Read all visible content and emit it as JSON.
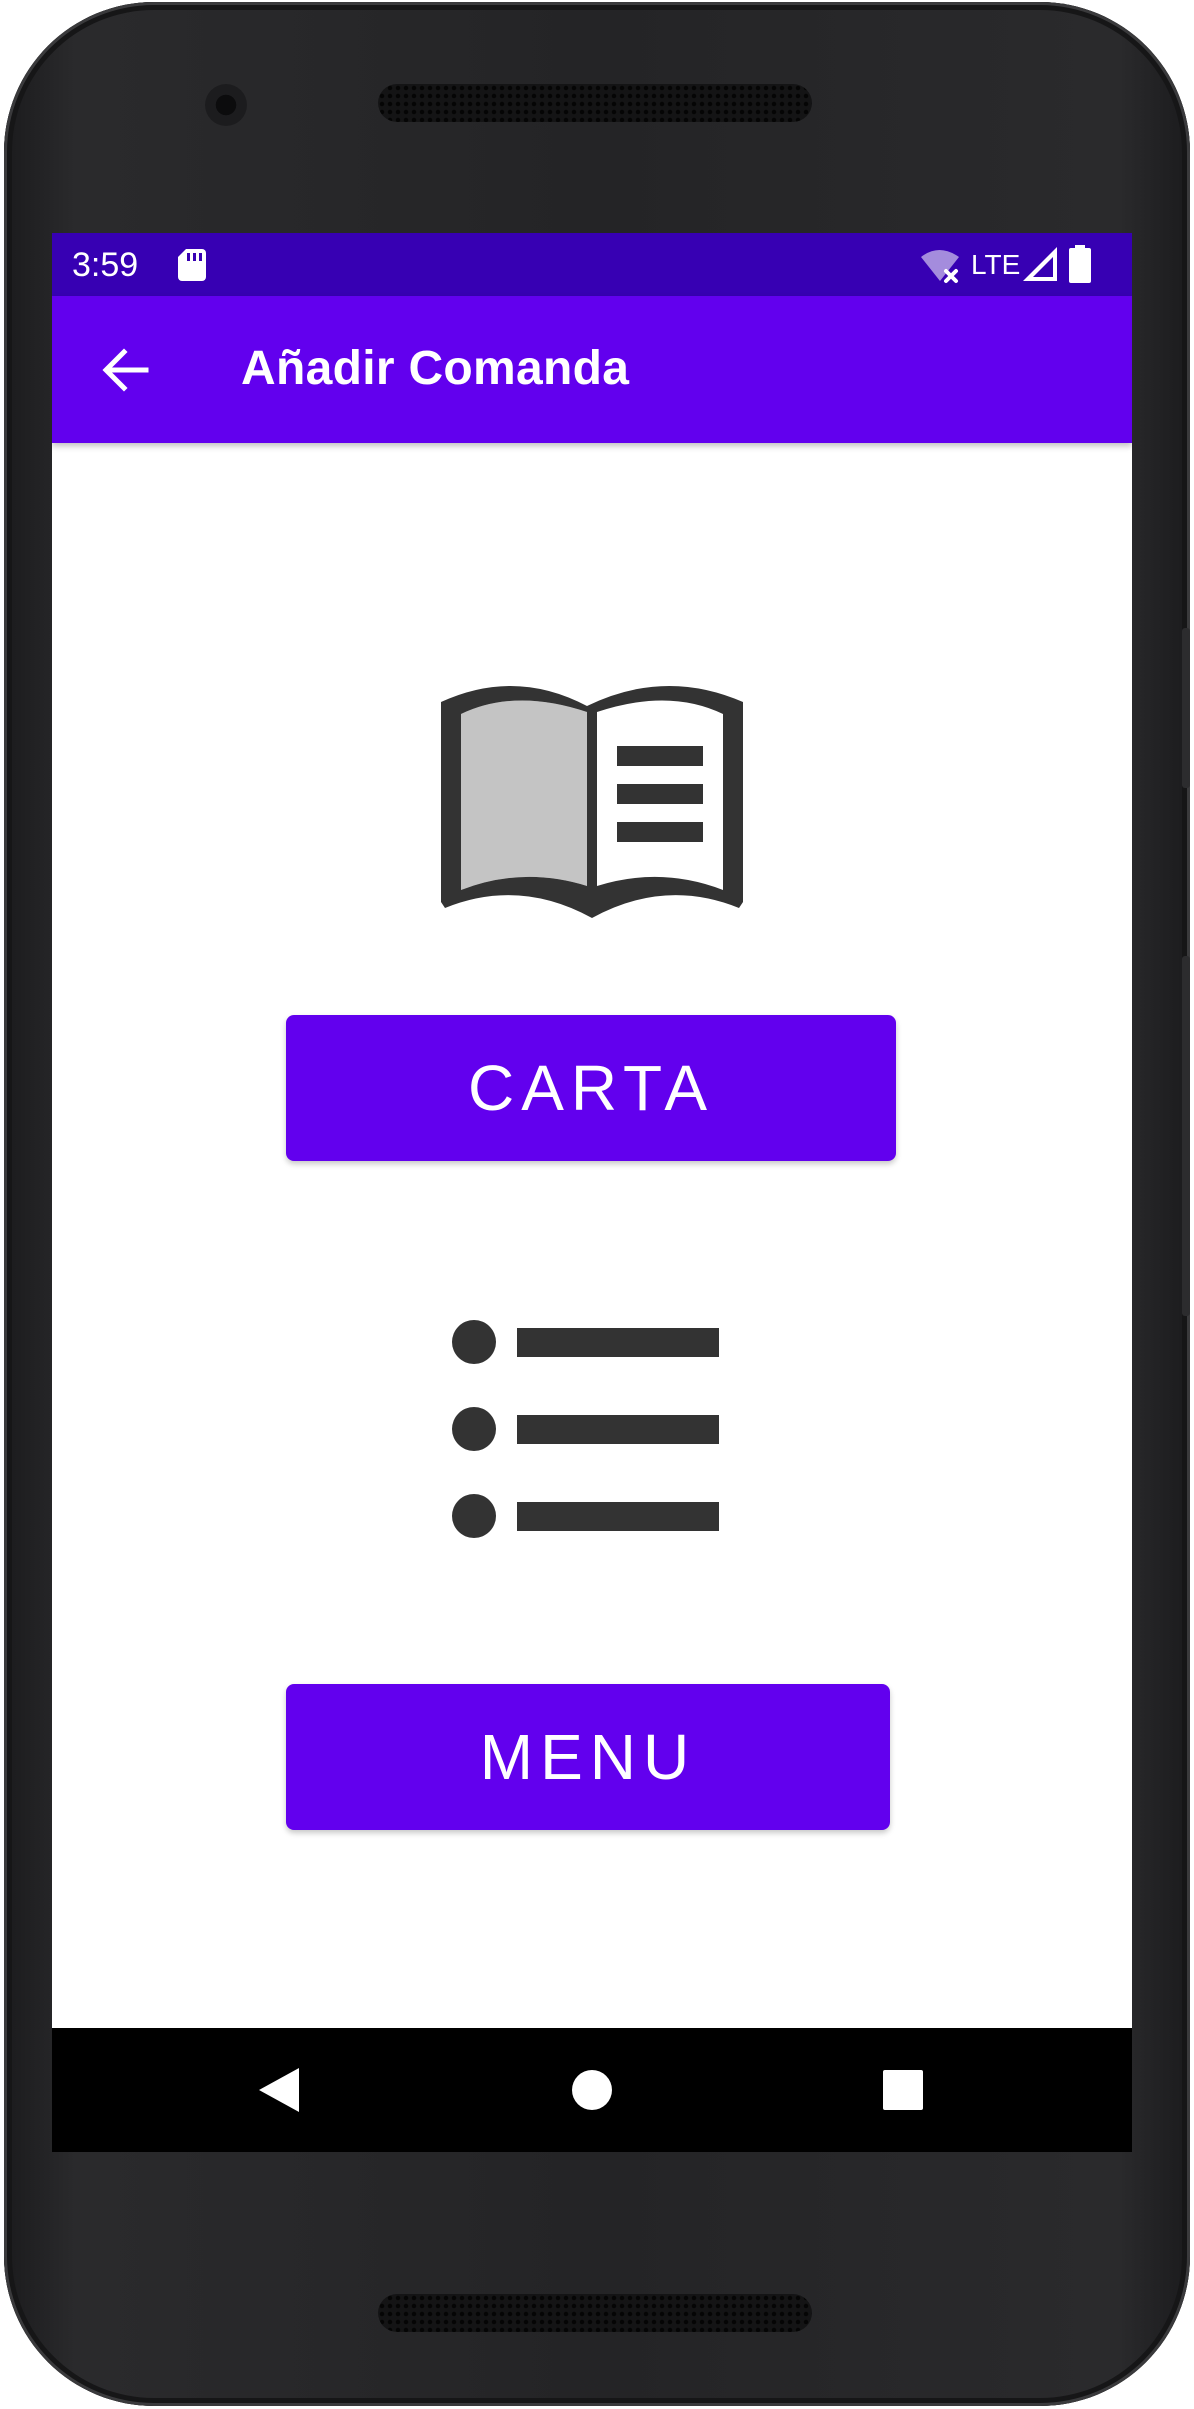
{
  "status_bar": {
    "time": "3:59",
    "network": "LTE",
    "icons": [
      "sd-card-icon",
      "wifi-off-icon",
      "signal-icon",
      "battery-icon"
    ]
  },
  "app_bar": {
    "title": "Añadir Comanda",
    "back_icon": "arrow-back-icon"
  },
  "content": {
    "carta_icon": "open-book-icon",
    "carta_button": "CARTA",
    "menu_icon": "bulleted-list-icon",
    "menu_button": "MENU"
  },
  "nav_bar": {
    "icons": [
      "nav-back-icon",
      "nav-home-icon",
      "nav-recents-icon"
    ]
  },
  "colors": {
    "status_bar": "#3700b3",
    "primary": "#6200ee",
    "icon": "#333333",
    "book_page_fill": "#c4c4c4"
  }
}
